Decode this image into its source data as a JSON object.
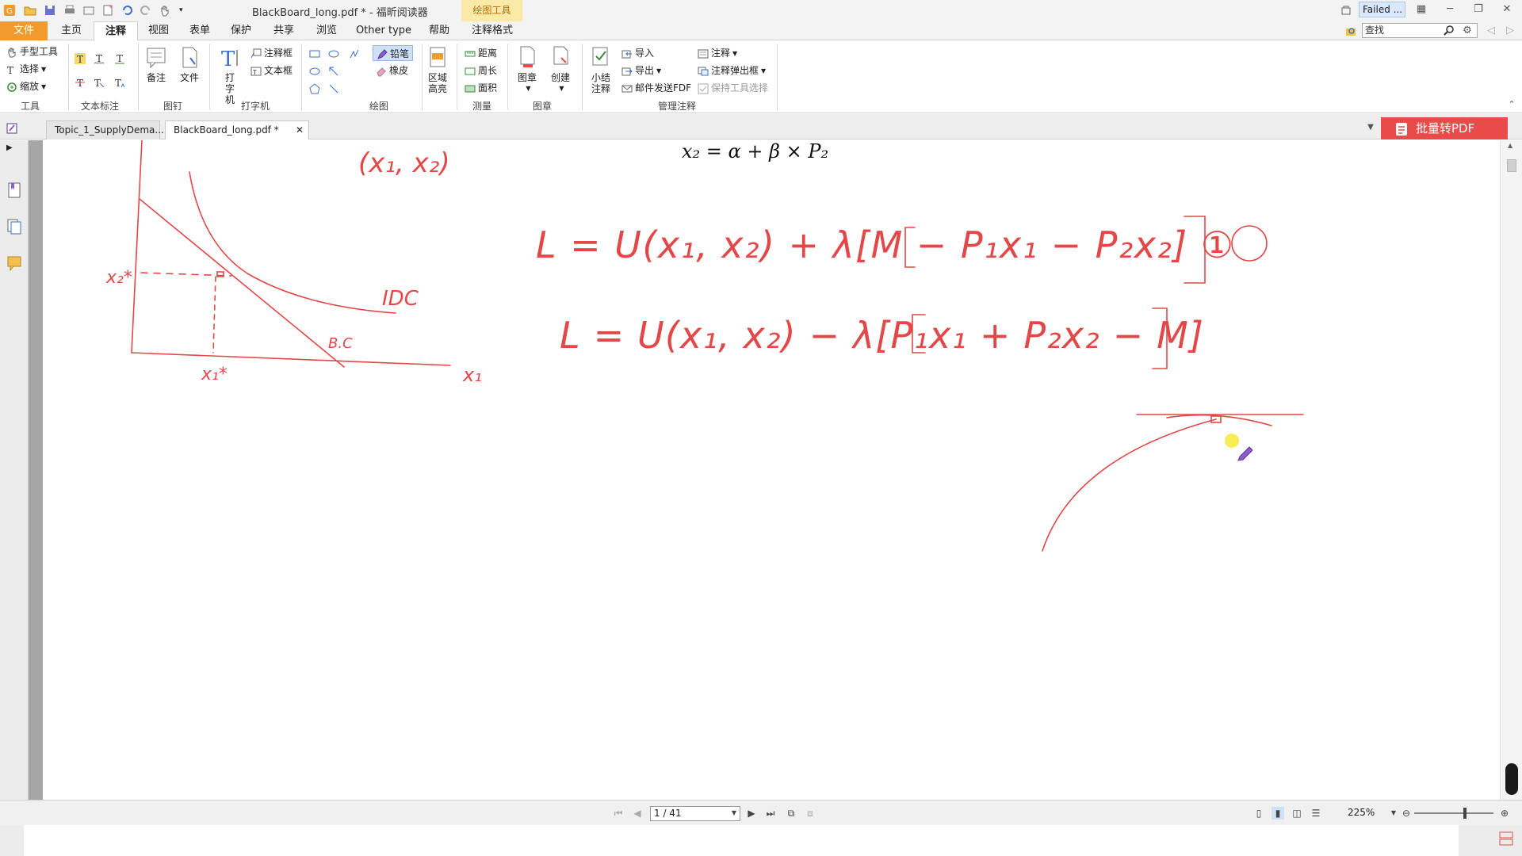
{
  "window": {
    "title": "BlackBoard_long.pdf * - 福昕阅读器",
    "context_tab": "绘图工具",
    "failed_badge": "Failed ..."
  },
  "menu": {
    "file": "文件",
    "items": [
      "主页",
      "注释",
      "视图",
      "表单",
      "保护",
      "共享",
      "浏览",
      "Other type",
      "帮助",
      "注释格式"
    ],
    "active": "注释"
  },
  "search": {
    "placeholder": "查找"
  },
  "ribbon": {
    "tools": {
      "hand": "手型工具",
      "select": "选择",
      "zoom": "缩放",
      "label": "工具"
    },
    "text_markup": {
      "label": "文本标注"
    },
    "pin": {
      "note": "备注",
      "file": "文件",
      "label": "图钉"
    },
    "typewriter": {
      "type": "打字机",
      "callout": "注释框",
      "textbox": "文本框",
      "label": "打字机"
    },
    "drawing": {
      "pencil": "铅笔",
      "eraser": "橡皮",
      "area_highlight": "区域高亮",
      "label": "绘图"
    },
    "measure": {
      "distance": "距离",
      "perimeter": "周长",
      "area": "面积",
      "label": "测量"
    },
    "stamp": {
      "stamp": "图章",
      "create": "创建",
      "label": "图章"
    },
    "manage": {
      "summarize": "小结注释",
      "import": "导入",
      "export": "导出",
      "email": "邮件发送FDF",
      "comment": "注释",
      "popup": "注释弹出框",
      "keep_tool": "保持工具选择",
      "label": "管理注释"
    }
  },
  "doc_tabs": [
    "Topic_1_SupplyDema...",
    "BlackBoard_long.pdf *"
  ],
  "batch_button": "批量转PDF",
  "page": {
    "formula_top": "x₂ = α + β × P₂",
    "handwriting": {
      "point": "(x₁, x₂)",
      "eq1": "L = U(x₁, x₂) + λ[M − P₁x₁ − P₂x₂] ①",
      "eq2": "L = U(x₁, x₂) − λ[P₁x₁ + P₂x₂ − M]",
      "idc": "IDC",
      "bc": "B.C",
      "x1_axis": "x₁",
      "x1_star": "x₁*",
      "x2_star": "x₂*"
    }
  },
  "status": {
    "page_field": "1 / 41",
    "zoom": "225%"
  },
  "colors": {
    "ink": "#e24848",
    "file_tab": "#f29a2e",
    "batch": "#e94b4b",
    "context_tab_bg": "#fbe9a7",
    "cursor_highlight": "#f4ea3a"
  }
}
